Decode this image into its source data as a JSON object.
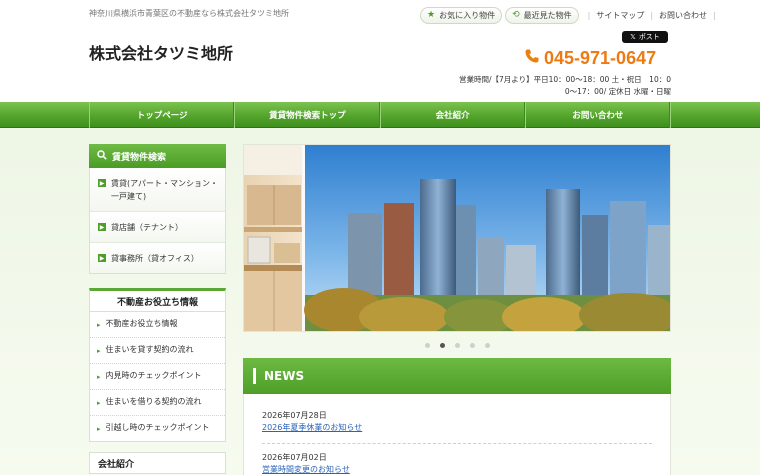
{
  "header": {
    "tagline": "神奈川県横浜市青葉区の不動産なら株式会社タツミ地所",
    "favorites_label": "お気に入り物件",
    "recent_label": "最近見た物件",
    "sitemap_label": "サイトマップ",
    "contact_label": "お問い合わせ",
    "x_post_label": "ポスト",
    "company_name": "株式会社タツミ地所",
    "phone": "045-971-0647",
    "hours_line1": "営業時間/【7月より】平日10：00～18：00 土・祝日　10：0",
    "hours_line2": "0～17：00/ 定休日 水曜・日曜"
  },
  "nav": {
    "items": [
      {
        "label": "トップページ"
      },
      {
        "label": "賃貸物件検索トップ"
      },
      {
        "label": "会社紹介"
      },
      {
        "label": "お問い合わせ"
      }
    ]
  },
  "sidebar": {
    "search_title": "賃貸物件検索",
    "search_items": [
      {
        "label": "賃貸(アパート・マンション・一戸建て)"
      },
      {
        "label": "貸店舗（テナント）"
      },
      {
        "label": "貸事務所（貸オフィス）"
      }
    ],
    "tips_title": "不動産お役立ち情報",
    "tips_items": [
      {
        "label": "不動産お役立ち情報"
      },
      {
        "label": "住まいを貸す契約の流れ"
      },
      {
        "label": "内見時のチェックポイント"
      },
      {
        "label": "住まいを借りる契約の流れ"
      },
      {
        "label": "引越し時のチェックポイント"
      }
    ],
    "company_title": "会社紹介"
  },
  "slider": {
    "slide_count": 5,
    "active_index": 1
  },
  "news": {
    "title": "NEWS",
    "items": [
      {
        "date": "2026年07月28日",
        "title": "2026年夏季休業のお知らせ"
      },
      {
        "date": "2026年07月02日",
        "title": "営業時間変更のお知らせ"
      }
    ]
  },
  "colors": {
    "brand_green": "#54a52d",
    "phone_orange": "#ee7a12",
    "link_blue": "#2a64b8"
  }
}
